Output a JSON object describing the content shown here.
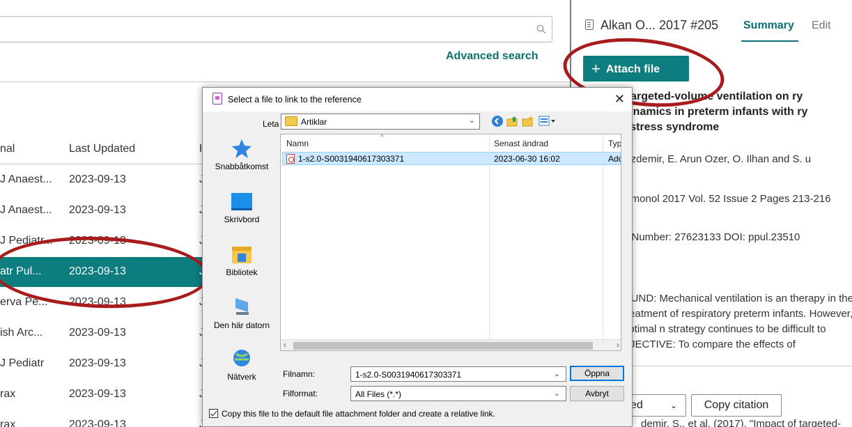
{
  "search": {
    "placeholder": "",
    "advanced_label": "Advanced search"
  },
  "table": {
    "headers": [
      "nal",
      "Last Updated"
    ],
    "rows": [
      {
        "journal": "J Anaest...",
        "updated": "2023-09-13",
        "extra": "J"
      },
      {
        "journal": "J Anaest...",
        "updated": "2023-09-13",
        "extra": "J"
      },
      {
        "journal": "J Pediatr...",
        "updated": "2023-09-13",
        "extra": "J"
      },
      {
        "journal": "atr Pul...",
        "updated": "2023-09-13",
        "extra": "J"
      },
      {
        "journal": "erva Pe...",
        "updated": "2023-09-13",
        "extra": "J"
      },
      {
        "journal": "ish Arc...",
        "updated": "2023-09-13",
        "extra": "J"
      },
      {
        "journal": "J Pediatr",
        "updated": "2023-09-13",
        "extra": "J"
      },
      {
        "journal": "rax",
        "updated": "2023-09-13",
        "extra": "J"
      },
      {
        "journal": "rax",
        "updated": "2023-09-13",
        "extra": "J"
      }
    ],
    "selected_index": 3
  },
  "reference": {
    "title": "Alkan O... 2017 #205",
    "tab_summary": "Summary",
    "tab_edit": "Edit",
    "attach_label": "Attach file",
    "abstract_title": "f targeted-volume ventilation on ry dynamics in preterm infants with ry distress syndrome",
    "authors": "Özdemir, E. Arun Ozer, O. Ilhan and S. u",
    "journal": "ulmonol 2017 Vol. 52 Issue 2 Pages 213-216",
    "accession": "n Number: 27623133 DOI: ppul.23510",
    "abstract": "OUND: Mechanical ventilation is an therapy in the treatment of respiratory preterm infants. However, optimal n strategy continues to be difficult to BJECTIVE: To compare the effects of",
    "style_select": "ed",
    "copy_citation": "Copy citation",
    "citation_text": "demir, S., et al. (2017). \"Impact of targeted-"
  },
  "dialog": {
    "title": "Select a file to link to the reference",
    "look_in_label": "Leta i:",
    "look_in_value": "Artiklar",
    "places": [
      "Snabbåtkomst",
      "Skrivbord",
      "Bibliotek",
      "Den här datorn",
      "Nätverk"
    ],
    "columns": [
      "Namn",
      "Senast ändrad",
      "Typ"
    ],
    "file": {
      "name": "1-s2.0-S0031940617303371",
      "modified": "2023-06-30 16:02",
      "type": "Adob"
    },
    "filename_label": "Filnamn:",
    "filename_value": "1-s2.0-S0031940617303371",
    "filetype_label": "Filformat:",
    "filetype_value": "All Files (*.*)",
    "open_button": "Öppna",
    "cancel_button": "Avbryt",
    "copy_checkbox_label": "Copy this file to the default file attachment folder and create a relative link."
  }
}
